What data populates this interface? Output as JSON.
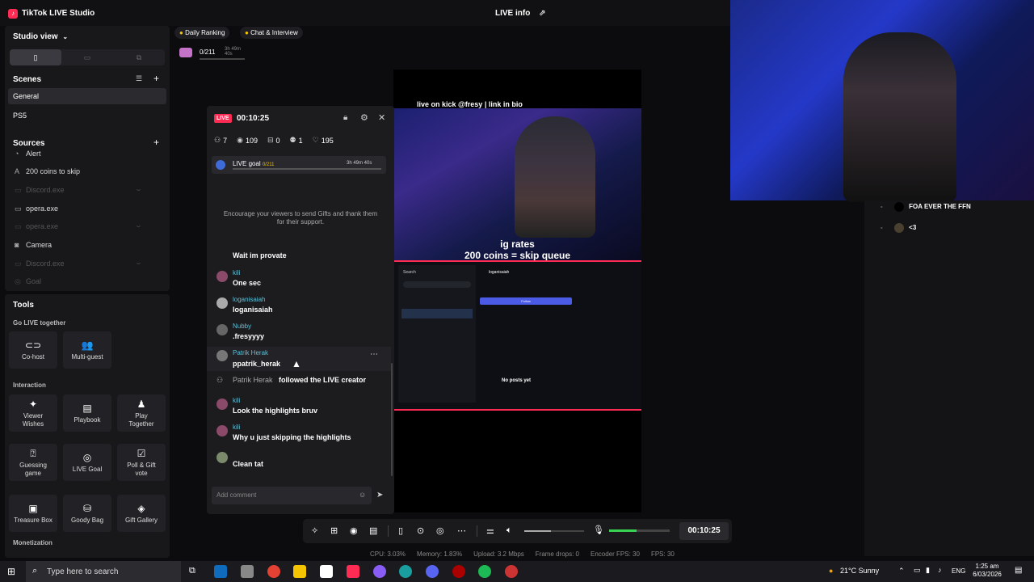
{
  "app": {
    "title": "TikTok LIVE Studio",
    "live_info": "LIVE info"
  },
  "studio": {
    "view": "Studio view"
  },
  "scenes": {
    "title": "Scenes",
    "items": [
      "General",
      "PS5"
    ]
  },
  "sources": {
    "title": "Sources",
    "items": [
      {
        "label": "Alert",
        "dim": false
      },
      {
        "label": "200 coins to skip",
        "dim": false
      },
      {
        "label": "Discord.exe",
        "dim": true
      },
      {
        "label": "opera.exe",
        "dim": false
      },
      {
        "label": "opera.exe",
        "dim": true
      },
      {
        "label": "Camera",
        "dim": false
      },
      {
        "label": "Discord.exe",
        "dim": true
      },
      {
        "label": "Goal",
        "dim": true
      }
    ]
  },
  "tools": {
    "title": "Tools",
    "go_live": "Go LIVE together",
    "cohost": "Co-host",
    "multiguest": "Multi-guest",
    "interaction": "Interaction",
    "viewer_wishes": "Viewer Wishes",
    "playbook": "Playbook",
    "play_together": "Play Together",
    "guessing_game": "Guessing game",
    "live_goal": "LIVE Goal",
    "poll": "Poll & Gift vote",
    "treasure_box": "Treasure Box",
    "goody_bag": "Goody Bag",
    "gift_gallery": "Gift Gallery",
    "monetization": "Monetization"
  },
  "top_chips": {
    "daily_ranking": "Daily Ranking",
    "chat_interview": "Chat & Interview",
    "goal_progress": "0/211",
    "goal_time": "3h 49m 40s"
  },
  "panel": {
    "live_badge": "LIVE",
    "timer": "00:10:25",
    "stats": {
      "viewers": "7",
      "views": "109",
      "gifts": "0",
      "followers": "1",
      "likes": "195"
    },
    "goal_label": "LIVE goal",
    "goal_count": "0/211",
    "goal_time": "3h 49m 40s",
    "encourage": "Encourage your viewers to send Gifts and thank them for their support.",
    "comment_placeholder": "Add comment"
  },
  "chat": [
    {
      "name": "",
      "text": "Wait im provate"
    },
    {
      "name": "kili",
      "text": "One sec"
    },
    {
      "name": "loganisaiah",
      "text": "loganisaiah"
    },
    {
      "name": "Nubby",
      "text": ".fresyyyy"
    },
    {
      "name": "Patrik Herak",
      "text": "ppatrik_herak"
    },
    {
      "name": "kili",
      "text": "Look the highlights bruv"
    },
    {
      "name": "kili",
      "text": "Why u just skipping the highlights"
    },
    {
      "name": "",
      "text": "Clean tat"
    }
  ],
  "follow_event": {
    "name": "Patrik Herak",
    "text": "followed the LIVE creator"
  },
  "stream": {
    "overlay_top": "live on kick @fresy | link in bio",
    "rates_line1": "ig rates",
    "rates_line2": "200 coins = skip queue",
    "mini_search": "Search",
    "mini_user": "loganisaiah",
    "mini_follow": "Follow",
    "mini_noposts": "No posts yet"
  },
  "right_list": [
    {
      "text": "FOA EVER THE FFN"
    },
    {
      "text": "<3"
    }
  ],
  "controls": {
    "timer": "00:10:25",
    "volume_fraction": 0.45,
    "mic_fraction": 0.45
  },
  "statusbar": {
    "cpu": "CPU: 3.03%",
    "memory": "Memory: 1.83%",
    "upload": "Upload: 3.2 Mbps",
    "frame_drops": "Frame drops: 0",
    "encoder_fps": "Encoder FPS: 30",
    "fps": "FPS: 30"
  },
  "taskbar": {
    "search": "Type here to search",
    "weather": "21°C Sunny",
    "lang": "ENG",
    "time": "1:25 am",
    "date": "6/03/2026"
  },
  "colors": {
    "accent": "#fe2c55",
    "cyan": "#25d1e0",
    "green": "#39d353",
    "panel": "#1c1c1f"
  }
}
